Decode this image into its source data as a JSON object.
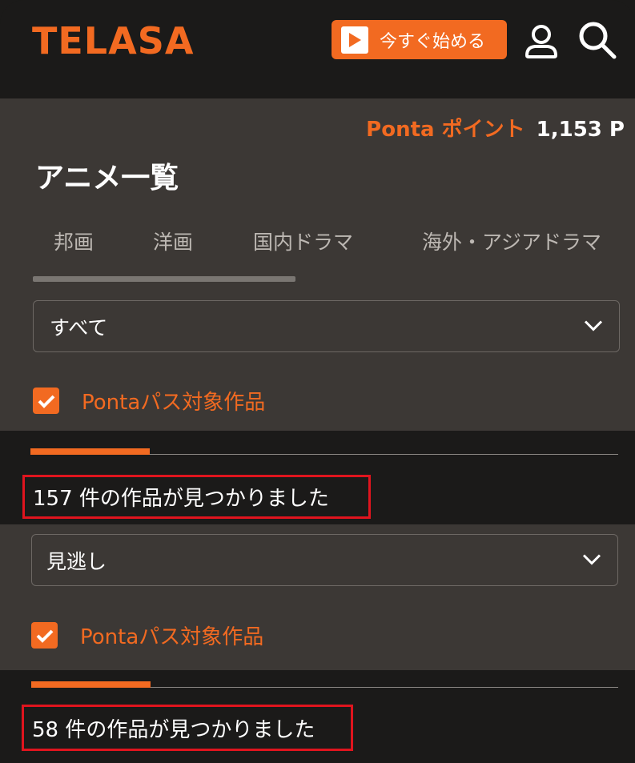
{
  "header": {
    "logo_text": "TELASA",
    "start_button_label": "今すぐ始める",
    "icons": [
      "play-icon",
      "user-icon",
      "search-icon"
    ]
  },
  "points": {
    "label": "Ponta ポイント",
    "value": "1,153 P"
  },
  "page_title": "アニメ一覧",
  "tabs": [
    "邦画",
    "洋画",
    "国内ドラマ",
    "海外・アジアドラマ"
  ],
  "filter1": {
    "select_value": "すべて",
    "checkbox_label": "Pontaパス対象作品",
    "checked": true,
    "result_text": "157 件の作品が見つかりました"
  },
  "filter2": {
    "select_value": "見逃し",
    "checkbox_label": "Pontaパス対象作品",
    "checked": true,
    "result_text": "58 件の作品が見つかりました"
  },
  "colors": {
    "accent": "#f26a21",
    "header_bg": "#1b1a19",
    "panel_bg": "#3c3835",
    "highlight_border": "#e0141e"
  }
}
